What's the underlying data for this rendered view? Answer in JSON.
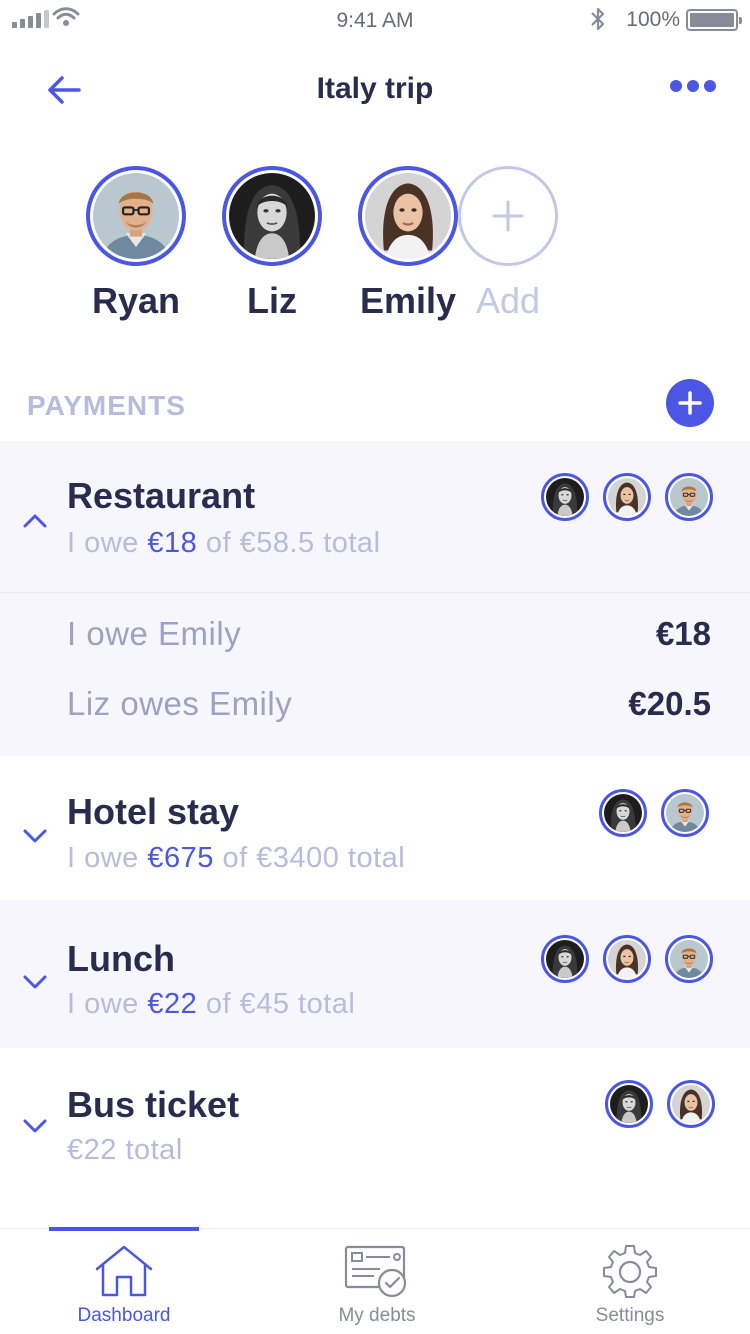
{
  "status_bar": {
    "time": "9:41 AM",
    "battery": "100%"
  },
  "nav": {
    "title": "Italy trip"
  },
  "members": [
    {
      "name": "Ryan"
    },
    {
      "name": "Liz"
    },
    {
      "name": "Emily"
    }
  ],
  "add_member": {
    "label": "Add"
  },
  "payments": {
    "title": "PAYMENTS",
    "items": [
      {
        "title": "Restaurant",
        "sub_prefix": "I owe ",
        "sub_amount": "€18",
        "sub_suffix": " of €58.5 total",
        "expanded": true,
        "participants": [
          "Liz",
          "Emily",
          "Ryan"
        ],
        "breakdown": [
          {
            "label": "I owe Emily",
            "amount": "€18"
          },
          {
            "label": "Liz owes Emily",
            "amount": "€20.5"
          }
        ]
      },
      {
        "title": "Hotel stay",
        "sub_prefix": "I owe ",
        "sub_amount": "€675",
        "sub_suffix": " of €3400 total",
        "expanded": false,
        "participants": [
          "Liz",
          "Ryan"
        ]
      },
      {
        "title": "Lunch",
        "sub_prefix": "I owe ",
        "sub_amount": "€22",
        "sub_suffix": " of €45 total",
        "expanded": false,
        "participants": [
          "Liz",
          "Emily",
          "Ryan"
        ]
      },
      {
        "title": "Bus ticket",
        "sub_text": "€22 total",
        "expanded": false,
        "participants": [
          "Liz",
          "Emily"
        ]
      }
    ]
  },
  "tab_bar": {
    "tabs": [
      {
        "label": "Dashboard",
        "icon": "house-icon",
        "active": true
      },
      {
        "label": "My debts",
        "icon": "debts-card-icon",
        "active": false
      },
      {
        "label": "Settings",
        "icon": "gear-icon",
        "active": false
      }
    ]
  },
  "colors": {
    "accent": "#4b56e2",
    "text_dark": "#2a2c4e",
    "text_muted": "#b8bbdc",
    "row_tint": "#f6f6fc"
  }
}
